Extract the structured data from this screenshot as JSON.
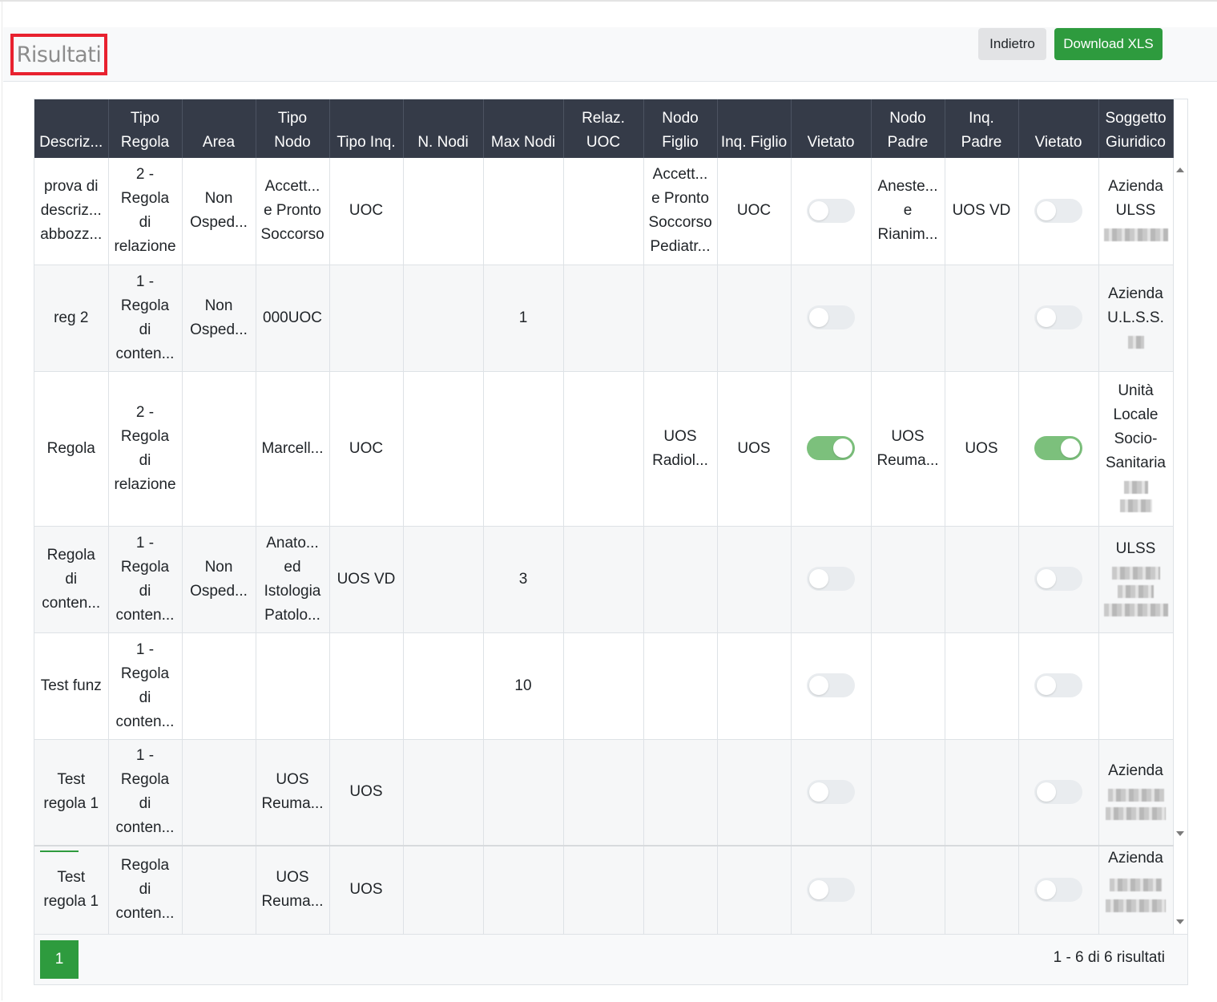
{
  "header": {
    "title": "Risultati",
    "back_label": "Indietro",
    "download_label": "Download XLS"
  },
  "table": {
    "columns": [
      "Descriz...",
      "Tipo Regola",
      "Area",
      "Tipo Nodo",
      "Tipo Inq.",
      "N. Nodi",
      "Max Nodi",
      "Relaz. UOC",
      "Nodo Figlio",
      "Inq. Figlio",
      "Vietato",
      "Nodo Padre",
      "Inq. Padre",
      "Vietato",
      "Soggetto Giuridico"
    ],
    "rows": [
      {
        "descrizione": "prova di descriz... abbozz...",
        "tipo_regola": "2 - Regola di relazione",
        "area": "Non Osped...",
        "tipo_nodo": "Accett... e Pronto Soccorso",
        "tipo_inq": "UOC",
        "n_nodi": "",
        "max_nodi": "",
        "relaz_uoc": "",
        "nodo_figlio": "Accett... e Pronto Soccorso Pediatr...",
        "inq_figlio": "UOC",
        "vietato_figlio": false,
        "nodo_padre": "Aneste... e Rianim...",
        "inq_padre": "UOS VD",
        "vietato_padre": false,
        "soggetto": "Azienda ULSS"
      },
      {
        "descrizione": "reg 2",
        "tipo_regola": "1 - Regola di conten...",
        "area": "Non Osped...",
        "tipo_nodo": "000UOC",
        "tipo_inq": "",
        "n_nodi": "",
        "max_nodi": "1",
        "relaz_uoc": "",
        "nodo_figlio": "",
        "inq_figlio": "",
        "vietato_figlio": false,
        "nodo_padre": "",
        "inq_padre": "",
        "vietato_padre": false,
        "soggetto": "Azienda U.L.S.S."
      },
      {
        "descrizione": "Regola",
        "tipo_regola": "2 - Regola di relazione",
        "area": "",
        "tipo_nodo": "Marcell...",
        "tipo_inq": "UOC",
        "n_nodi": "",
        "max_nodi": "",
        "relaz_uoc": "",
        "nodo_figlio": "UOS Radiol...",
        "inq_figlio": "UOS",
        "vietato_figlio": true,
        "nodo_padre": "UOS Reuma...",
        "inq_padre": "UOS",
        "vietato_padre": true,
        "soggetto": "Unità Locale Socio-Sanitaria"
      },
      {
        "descrizione": "Regola di conten...",
        "tipo_regola": "1 - Regola di conten...",
        "area": "Non Osped...",
        "tipo_nodo": "Anato... ed Istologia Patolo...",
        "tipo_inq": "UOS VD",
        "n_nodi": "",
        "max_nodi": "3",
        "relaz_uoc": "",
        "nodo_figlio": "",
        "inq_figlio": "",
        "vietato_figlio": false,
        "nodo_padre": "",
        "inq_padre": "",
        "vietato_padre": false,
        "soggetto": "ULSS"
      },
      {
        "descrizione": "Test funz",
        "tipo_regola": "1 - Regola di conten...",
        "area": "",
        "tipo_nodo": "",
        "tipo_inq": "",
        "n_nodi": "",
        "max_nodi": "10",
        "relaz_uoc": "",
        "nodo_figlio": "",
        "inq_figlio": "",
        "vietato_figlio": false,
        "nodo_padre": "",
        "inq_padre": "",
        "vietato_padre": false,
        "soggetto": ""
      },
      {
        "descrizione": "Test regola 1",
        "tipo_regola": "1 - Regola di conten...",
        "area": "",
        "tipo_nodo": "UOS Reuma...",
        "tipo_inq": "UOS",
        "n_nodi": "",
        "max_nodi": "",
        "relaz_uoc": "",
        "nodo_figlio": "",
        "inq_figlio": "",
        "vietato_figlio": false,
        "nodo_padre": "",
        "inq_padre": "",
        "vietato_padre": false,
        "soggetto": "Azienda"
      }
    ],
    "extra_row": {
      "descrizione": "Test regola 1",
      "tipo_regola": "Regola di conten...",
      "area": "",
      "tipo_nodo": "UOS Reuma...",
      "tipo_inq": "UOS",
      "soggetto": "Azienda"
    }
  },
  "footer": {
    "page": "1",
    "summary": "1 - 6 di 6 risultati"
  },
  "colors": {
    "header_bg": "#353b48",
    "accent_green": "#2e9b3e",
    "toggle_on": "#7cc07c",
    "title_border": "#e8212f"
  }
}
